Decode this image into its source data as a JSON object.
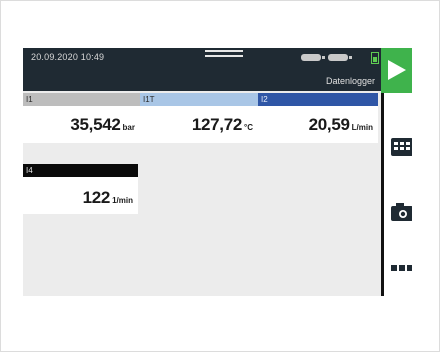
{
  "status_bar": {
    "datetime": "20.09.2020 10:49",
    "mode_label": "Datenlogger"
  },
  "tiles": [
    {
      "label": "I1",
      "value": "35,542",
      "unit": "bar",
      "header_color": "#bdbdbd"
    },
    {
      "label": "I1T",
      "value": "127,72",
      "unit": "°C",
      "header_color": "#a9c6e6"
    },
    {
      "label": "I2",
      "value": "20,59",
      "unit": "L/min",
      "header_color": "#2f56a6"
    },
    {
      "label": "I4",
      "value": "122",
      "unit": "1/min",
      "header_color": "#0a0a0a"
    }
  ],
  "side_panel": {
    "icons": [
      "play-icon",
      "grid-icon",
      "camera-icon",
      "more-icon"
    ],
    "accent_color": "#3fb34c"
  }
}
